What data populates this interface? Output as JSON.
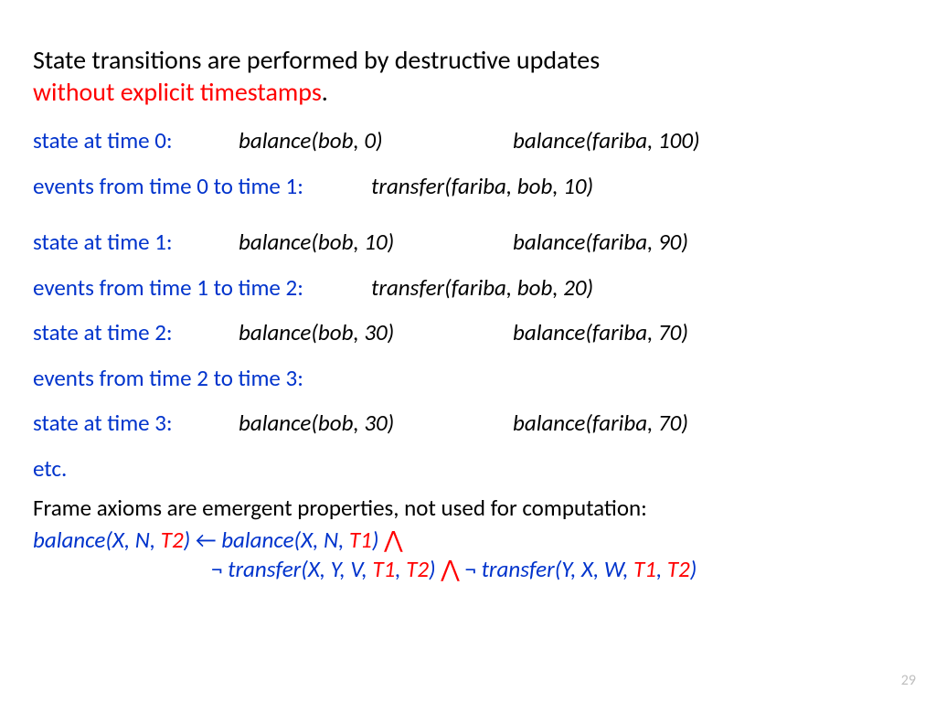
{
  "title_line1": "State transitions are performed by destructive  updates",
  "title_red": "without explicit timestamps",
  "title_period": ".",
  "rows": {
    "s0_label": "state at time 0:",
    "s0_bob": "balance(bob, 0)",
    "s0_fariba": "balance(fariba, 100)",
    "e0_label": "events from time 0 to time 1:",
    "e0_val": "transfer(fariba, bob, 10)",
    "s1_label": "state at time 1:",
    "s1_bob": "balance(bob, 10)",
    "s1_fariba": "balance(fariba, 90)",
    "e1_label": "events from time 1 to time 2:",
    "e1_val": "transfer(fariba, bob, 20)",
    "s2_label": "state at time 2:",
    "s2_bob": "balance(bob, 30)",
    "s2_fariba": "balance(fariba, 70)",
    "e2_label": "events from time 2 to time 3:",
    "s3_label": "state at time 3:",
    "s3_bob": "balance(bob, 30)",
    "s3_fariba": "balance(fariba, 70)",
    "etc": "etc."
  },
  "footer_text": "Frame axioms are emergent properties, not used for computation:",
  "axiom": {
    "b1": "balance(X, N, ",
    "t2": "T2",
    "close": ")",
    "arrow": " ←  ",
    "b2": "balance(X, N, ",
    "t1": "T1",
    "and": " ⋀",
    "neg1_pre": "¬ ",
    "neg1": "transfer(X, Y, V, ",
    "comma": ", ",
    "sp_and": "   ⋀ ",
    "neg2_pre": "¬ ",
    "neg2": "transfer(Y, X, W, "
  },
  "page_number": "29"
}
